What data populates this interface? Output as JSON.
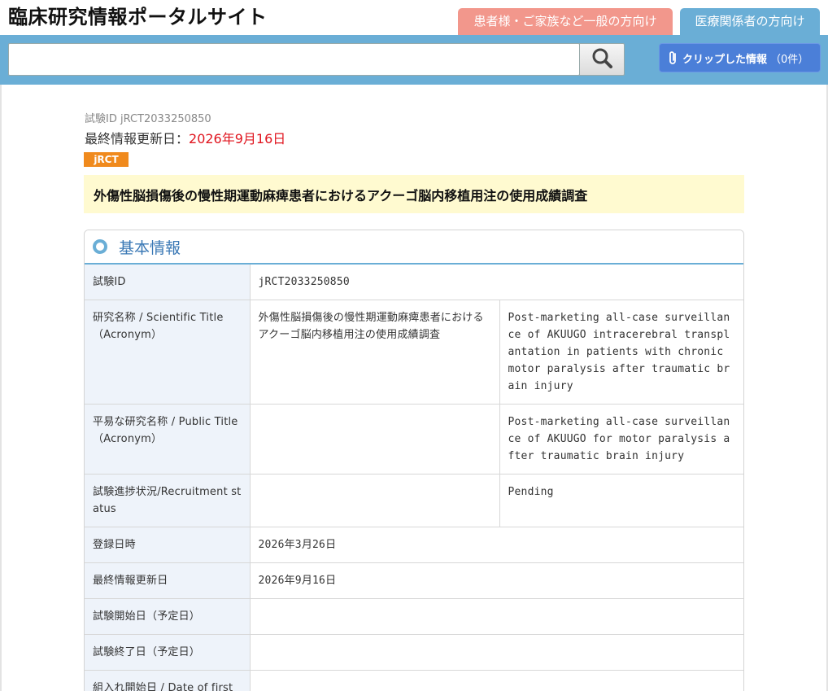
{
  "site": {
    "title": "臨床研究情報ポータルサイト",
    "tabs": {
      "patients": "患者様・ご家族など一般の方向け",
      "medical": "医療関係者の方向け"
    }
  },
  "search": {
    "value": "",
    "placeholder": ""
  },
  "clip": {
    "label": "クリップした情報",
    "count": "（0件）"
  },
  "trial": {
    "id_line": "試験ID jRCT2033250850",
    "updated_label": "最終情報更新日：",
    "updated_date": "2026年9月16日",
    "badge": "jRCT",
    "title": "外傷性脳損傷後の慢性期運動麻痺患者におけるアクーゴ脳内移植用注の使用成績調査"
  },
  "section": {
    "title": "基本情報",
    "rows": {
      "r1": {
        "label": "試験ID",
        "value": "jRCT2033250850"
      },
      "r2": {
        "label": "研究名称 / Scientific Title（Acronym）",
        "ja": "外傷性脳損傷後の慢性期運動麻痺患者におけるアクーゴ脳内移植用注の使用成績調査",
        "en": "Post-marketing all-case surveillance of AKUUGO intracerebral transplantation in patients with chronic motor paralysis after traumatic brain injury"
      },
      "r3": {
        "label": "平易な研究名称 / Public Title（Acronym）",
        "ja": "",
        "en": "Post-marketing all-case surveillance of AKUUGO for motor paralysis after traumatic brain injury"
      },
      "r4": {
        "label": "試験進捗状況/Recruitment status",
        "ja": "",
        "en": "Pending"
      },
      "r5": {
        "label": "登録日時",
        "value": "2026年3月26日"
      },
      "r6": {
        "label": "最終情報更新日",
        "value": "2026年9月16日"
      },
      "r7": {
        "label": "試験開始日（予定日）",
        "value": ""
      },
      "r8": {
        "label": "試験終了日（予定日）",
        "value": ""
      },
      "r9": {
        "label": "組入れ開始日 / Date of first enrollment",
        "value": ""
      }
    }
  }
}
